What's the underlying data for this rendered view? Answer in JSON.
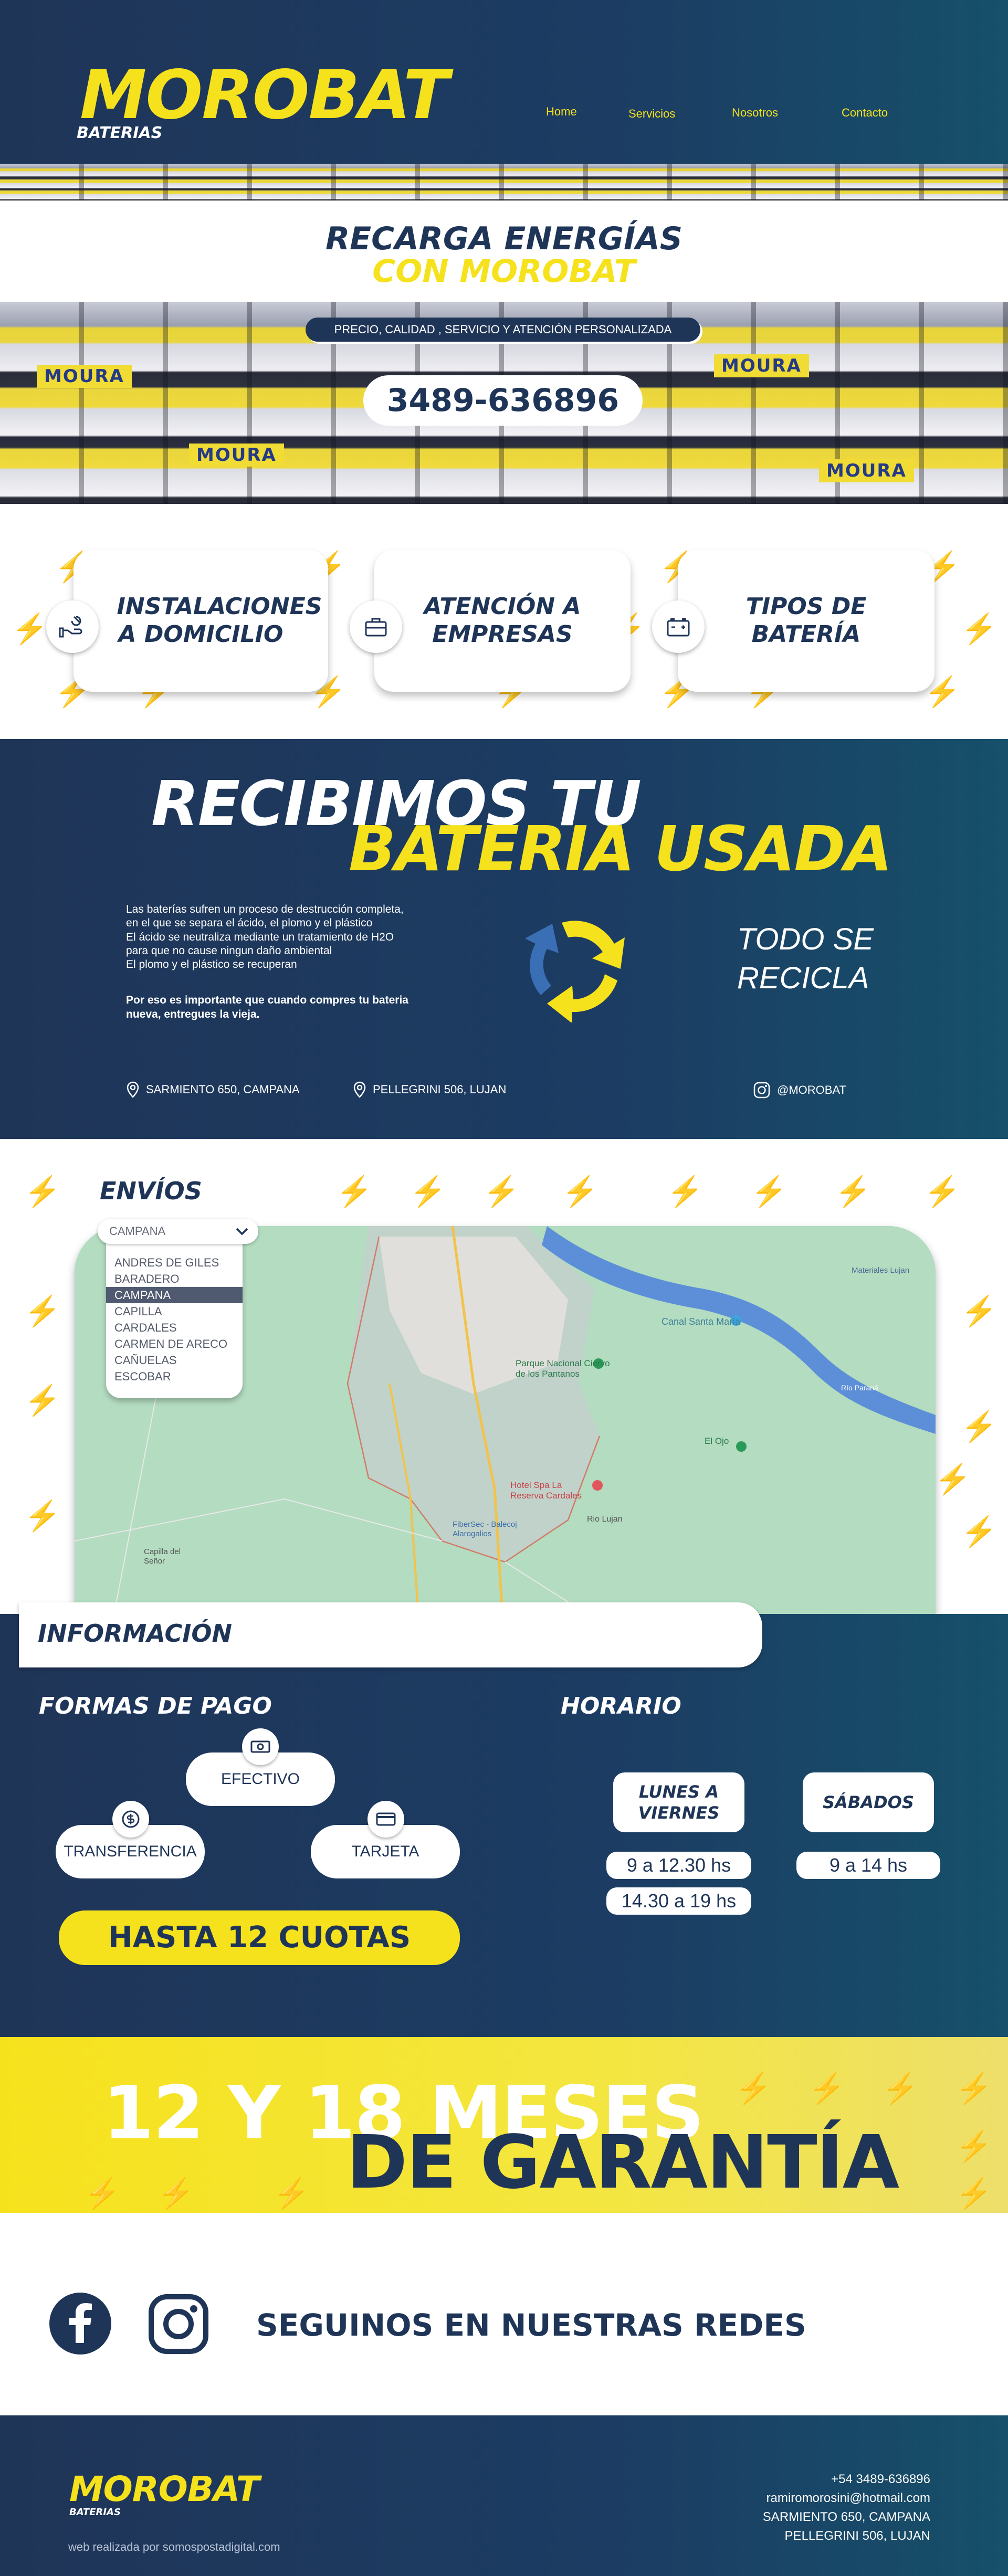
{
  "header": {
    "logo": "MOROBAT",
    "logo_sub": "BATERIAS",
    "nav": [
      "Home",
      "Servicios",
      "Nosotros",
      "Contacto"
    ]
  },
  "hero": {
    "title_line1": "RECARGA ENERGÍAS",
    "title_line2": "CON MOROBAT",
    "tagline": "PRECIO, CALIDAD , SERVICIO Y ATENCIÓN PERSONALIZADA",
    "phone": "3489-636896",
    "brand_tag": "MOURA"
  },
  "services": [
    {
      "title": "INSTALACIONES A DOMICILIO",
      "icon": "wrench-hand-icon"
    },
    {
      "title": "ATENCIÓN A EMPRESAS",
      "icon": "briefcase-icon"
    },
    {
      "title": "TIPOS DE BATERÍA",
      "icon": "battery-icon"
    }
  ],
  "recycle": {
    "title_line1": "RECIBIMOS TU",
    "title_line2": "BATERIA USADA",
    "para1": [
      "Las baterías sufren un proceso de destrucción completa,",
      "en el que se separa el ácido, el plomo y el plástico",
      "El ácido se neutraliza mediante un tratamiento de H2O",
      "para que no cause ningun daño ambiental",
      "El plomo y el plástico se recuperan"
    ],
    "para2": [
      "Por eso es importante que cuando compres tu bateria",
      "nueva, entregues la vieja."
    ],
    "todo_line1": "TODO SE",
    "todo_line2": "RECICLA",
    "address1": "SARMIENTO 650, CAMPANA",
    "address2": "PELLEGRINI 506, LUJAN",
    "instagram": "@MOROBAT"
  },
  "shipping": {
    "title": "ENVÍOS",
    "selected": "CAMPANA",
    "options": [
      "ANDRES DE GILES",
      "BARADERO",
      "CAMPANA",
      "CAPILLA",
      "CARDALES",
      "CARMEN DE ARECO",
      "CAÑUELAS",
      "ESCOBAR"
    ],
    "map_labels": [
      "Canal Santa María",
      "Parque Nacional Ciervo de los Pantanos",
      "Hotel Spa La Reserva Cardales",
      "Rio Lujan",
      "El Ojo",
      "Río Paraná",
      "FiberSec - Balecoj Alarogalios",
      "Capilla del Señor",
      "Materiales Lujan"
    ]
  },
  "info": {
    "title": "INFORMACIÓN",
    "payments_title": "FORMAS DE PAGO",
    "payments": [
      "EFECTIVO",
      "TRANSFERENCIA",
      "TARJETA"
    ],
    "cuotas": "HASTA 12 CUOTAS",
    "schedule_title": "HORARIO",
    "weekdays_label": "LUNES A VIERNES",
    "weekdays_hours": [
      "9 a 12.30 hs",
      "14.30 a 19 hs"
    ],
    "saturday_label": "SÁBADOS",
    "saturday_hours": "9 a 14 hs"
  },
  "warranty": {
    "line1": "12 Y 18 MESES",
    "line2": "DE GARANTÍA"
  },
  "social": {
    "title": "SEGUINOS EN NUESTRAS REDES"
  },
  "footer": {
    "logo": "MOROBAT",
    "logo_sub": "BATERIAS",
    "credit": "web realizada por somospostadigital.com",
    "contact": [
      "+54 3489-636896",
      "ramiromorosini@hotmail.com",
      "SARMIENTO 650, CAMPANA",
      "PELLEGRINI 506, LUJAN"
    ]
  },
  "colors": {
    "navy": "#1f3558",
    "yellow": "#f6e21c",
    "white": "#ffffff"
  }
}
